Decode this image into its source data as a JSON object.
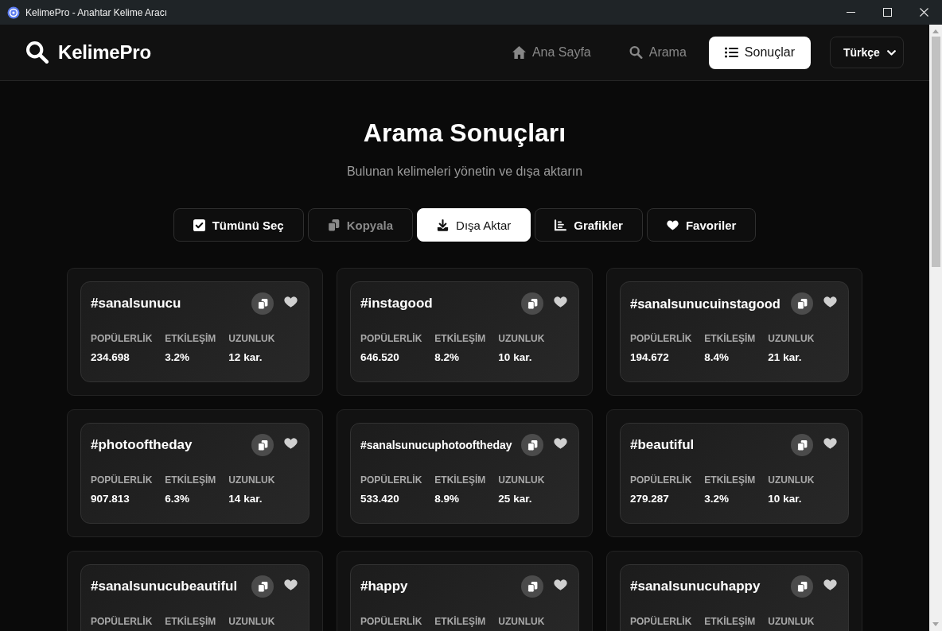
{
  "window": {
    "title": "KelimePro - Anahtar Kelime Aracı"
  },
  "header": {
    "logo": "KelimePro",
    "nav": [
      {
        "label": "Ana Sayfa",
        "selected": false
      },
      {
        "label": "Arama",
        "selected": false
      },
      {
        "label": "Sonuçlar",
        "selected": true
      }
    ],
    "language": "Türkçe"
  },
  "page": {
    "title": "Arama Sonuçları",
    "subtitle": "Bulunan kelimeleri yönetin ve dışa aktarın"
  },
  "toolbar": [
    {
      "label": "Tümünü Seç",
      "selected": false,
      "disabled": false
    },
    {
      "label": "Kopyala",
      "selected": false,
      "disabled": true
    },
    {
      "label": "Dışa Aktar",
      "selected": true,
      "disabled": false
    },
    {
      "label": "Grafikler",
      "selected": false,
      "disabled": false
    },
    {
      "label": "Favoriler",
      "selected": false,
      "disabled": false
    }
  ],
  "results": [
    {
      "tag": "#sanalsunucu",
      "metrics": [
        {
          "label": "POPÜLERLİK",
          "value": "234.698"
        },
        {
          "label": "ETKİLEŞİM",
          "value": "3.2%"
        },
        {
          "label": "UZUNLUK",
          "value": "12 kar."
        }
      ]
    },
    {
      "tag": "#instagood",
      "metrics": [
        {
          "label": "POPÜLERLİK",
          "value": "646.520"
        },
        {
          "label": "ETKİLEŞİM",
          "value": "8.2%"
        },
        {
          "label": "UZUNLUK",
          "value": "10 kar."
        }
      ]
    },
    {
      "tag": "#sanalsunucuinstagood",
      "metrics": [
        {
          "label": "POPÜLERLİK",
          "value": "194.672"
        },
        {
          "label": "ETKİLEŞİM",
          "value": "8.4%"
        },
        {
          "label": "UZUNLUK",
          "value": "21 kar."
        }
      ]
    },
    {
      "tag": "#photooftheday",
      "metrics": [
        {
          "label": "POPÜLERLİK",
          "value": "907.813"
        },
        {
          "label": "ETKİLEŞİM",
          "value": "6.3%"
        },
        {
          "label": "UZUNLUK",
          "value": "14 kar."
        }
      ]
    },
    {
      "tag": "#sanalsunucuphotooftheday",
      "metrics": [
        {
          "label": "POPÜLERLİK",
          "value": "533.420"
        },
        {
          "label": "ETKİLEŞİM",
          "value": "8.9%"
        },
        {
          "label": "UZUNLUK",
          "value": "25 kar."
        }
      ]
    },
    {
      "tag": "#beautiful",
      "metrics": [
        {
          "label": "POPÜLERLİK",
          "value": "279.287"
        },
        {
          "label": "ETKİLEŞİM",
          "value": "3.2%"
        },
        {
          "label": "UZUNLUK",
          "value": "10 kar."
        }
      ]
    },
    {
      "tag": "#sanalsunucubeautiful",
      "metrics": [
        {
          "label": "POPÜLERLİK"
        },
        {
          "label": "ETKİLEŞİM"
        },
        {
          "label": "UZUNLUK"
        }
      ]
    },
    {
      "tag": "#happy",
      "metrics": [
        {
          "label": "POPÜLERLİK"
        },
        {
          "label": "ETKİLEŞİM"
        },
        {
          "label": "UZUNLUK"
        }
      ]
    },
    {
      "tag": "#sanalsunucuhappy",
      "metrics": [
        {
          "label": "POPÜLERLİK"
        },
        {
          "label": "ETKİLEŞİM"
        },
        {
          "label": "UZUNLUK"
        }
      ]
    }
  ]
}
